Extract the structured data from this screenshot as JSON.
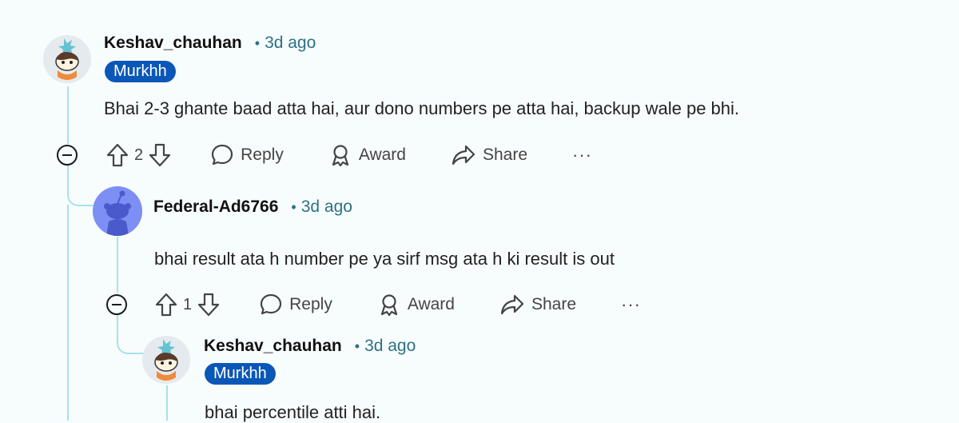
{
  "comments": [
    {
      "username": "Keshav_chauhan",
      "dot": "•",
      "time": "3d ago",
      "flair": "Murkhh",
      "body": "Bhai 2-3 ghante baad atta hai, aur dono numbers pe atta hai, backup wale pe bhi.",
      "votes": "2",
      "reply_label": "Reply",
      "award_label": "Award",
      "share_label": "Share",
      "more_label": "···"
    },
    {
      "username": "Federal-Ad6766",
      "dot": "•",
      "time": "3d ago",
      "body": "bhai result ata h number pe ya sirf msg ata h ki result is out",
      "votes": "1",
      "reply_label": "Reply",
      "award_label": "Award",
      "share_label": "Share",
      "more_label": "···"
    },
    {
      "username": "Keshav_chauhan",
      "dot": "•",
      "time": "3d ago",
      "flair": "Murkhh",
      "body": "bhai percentile atti hai."
    }
  ],
  "colors": {
    "thread_line": "#a8e1ea",
    "flair_bg": "#0b57b8",
    "timestamp": "#2d7184",
    "default_avatar_bg": "#7d8ff5"
  }
}
